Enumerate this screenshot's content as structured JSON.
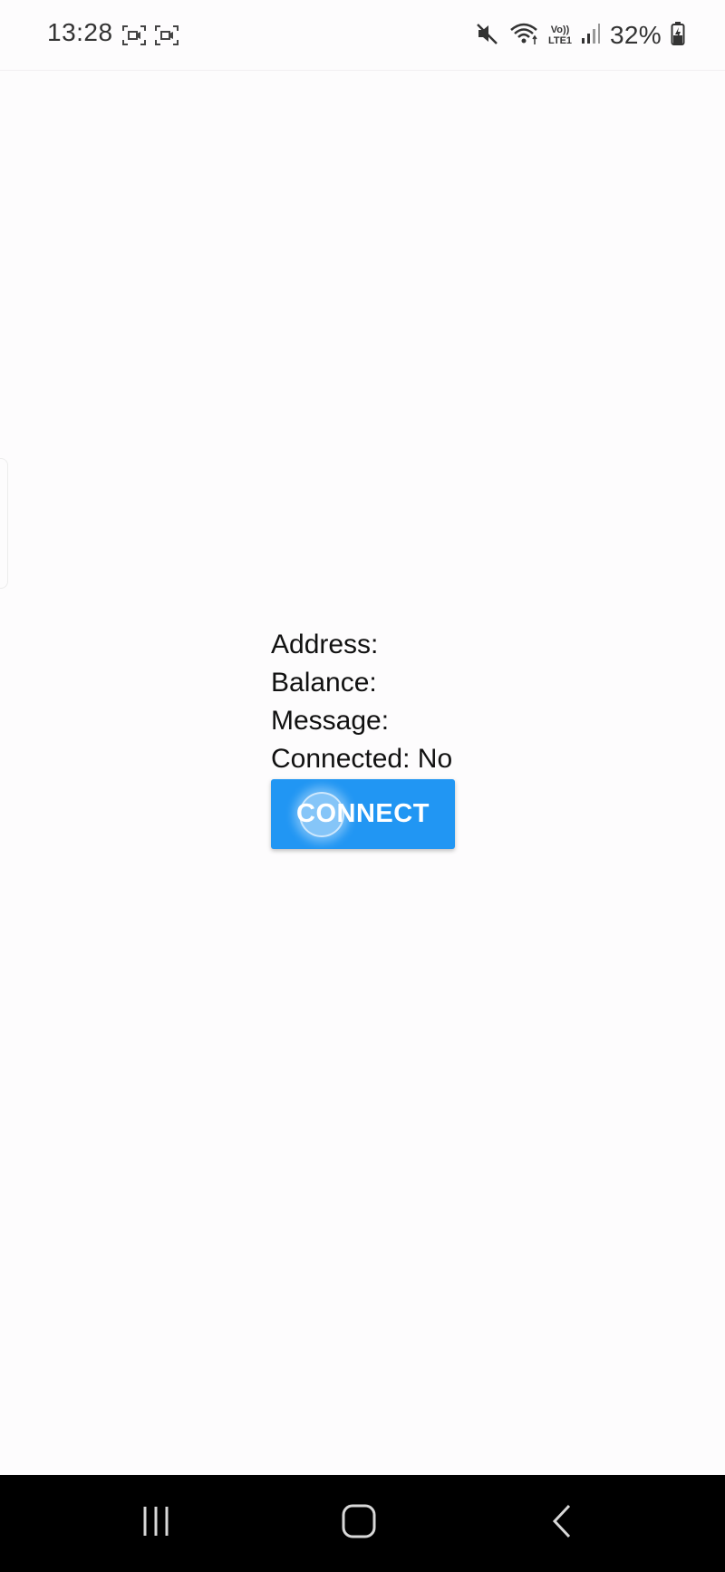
{
  "status_bar": {
    "time": "13:28",
    "battery_percent": "32%",
    "left_icons": [
      "screen-record-icon",
      "screen-record-icon"
    ],
    "right_icons": [
      "mute-icon",
      "wifi-icon",
      "volte-lte-icon",
      "signal-icon",
      "battery-charging-icon"
    ],
    "volte_label_top": "Vo))",
    "volte_label_bottom": "LTE1"
  },
  "main": {
    "address_label": "Address:",
    "balance_label": "Balance:",
    "message_label": "Message:",
    "connected_label": "Connected: No",
    "connect_button_label": "CONNECT"
  },
  "nav_bar": {
    "buttons": [
      "recent-apps",
      "home",
      "back"
    ]
  },
  "colors": {
    "accent": "#2196f3",
    "background": "#fdfcfd",
    "nav_background": "#000000"
  }
}
